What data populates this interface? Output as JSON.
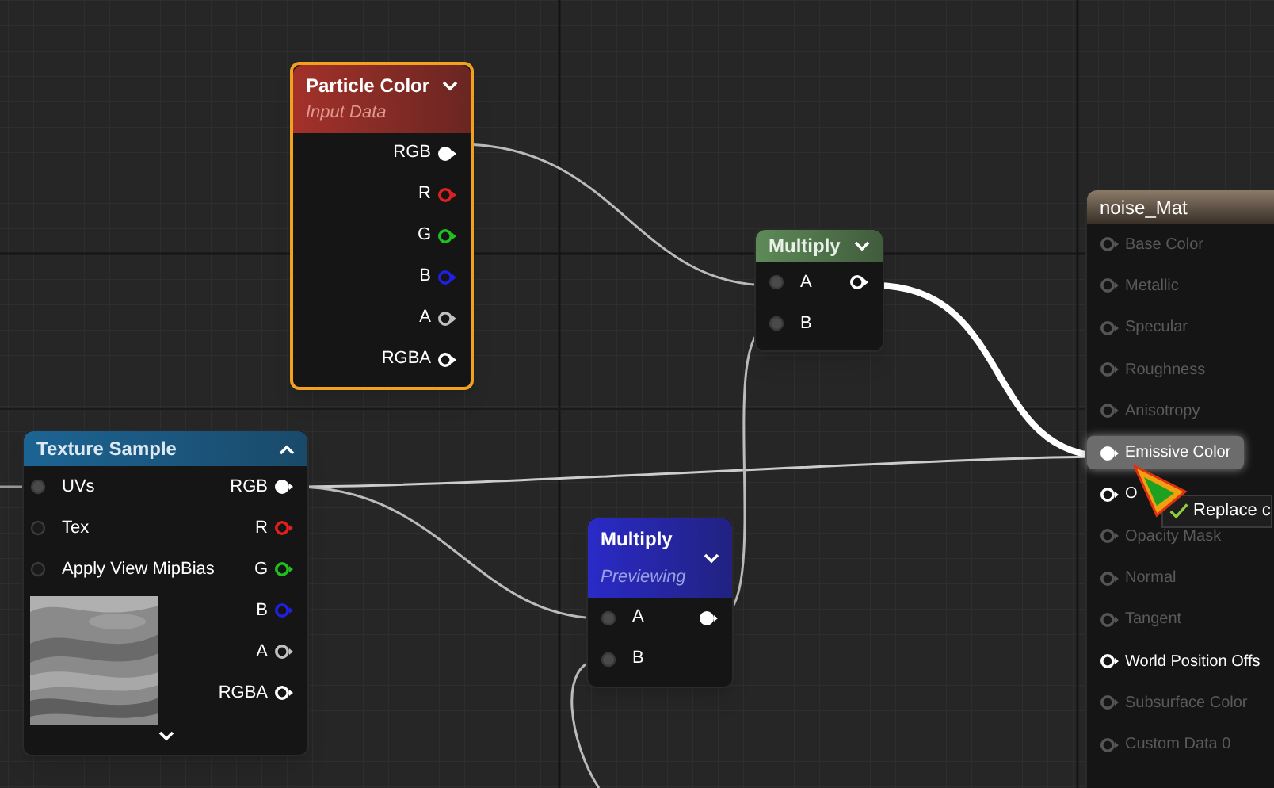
{
  "nodes": [
    {
      "kind": "expression",
      "title": "Particle Color",
      "subtitle": "Input Data",
      "selected": true,
      "previewing": false,
      "advanced_expanded": false,
      "outputs": [
        {
          "label": "RGB",
          "color": "#ffffff",
          "connected": true
        },
        {
          "label": "R",
          "color": "#e02020",
          "connected": false
        },
        {
          "label": "G",
          "color": "#20c020",
          "connected": false
        },
        {
          "label": "B",
          "color": "#2020e0",
          "connected": false
        },
        {
          "label": "A",
          "color": "#c0c0c0",
          "connected": false
        },
        {
          "label": "RGBA",
          "color": "#ffffff",
          "connected": false
        }
      ]
    },
    {
      "kind": "texture",
      "title": "Texture Sample",
      "selected": false,
      "advanced_expanded": true,
      "inputs": [
        {
          "label": "UVs",
          "connected": true
        },
        {
          "label": "Tex",
          "connected": false
        },
        {
          "label": "Apply View MipBias",
          "connected": false
        }
      ],
      "outputs": [
        {
          "label": "RGB",
          "color": "#ffffff",
          "connected": true
        },
        {
          "label": "R",
          "color": "#e02020",
          "connected": false
        },
        {
          "label": "G",
          "color": "#20c020",
          "connected": false
        },
        {
          "label": "B",
          "color": "#2020e0",
          "connected": false
        },
        {
          "label": "A",
          "color": "#c0c0c0",
          "connected": false
        },
        {
          "label": "RGBA",
          "color": "#ffffff",
          "connected": false
        }
      ]
    },
    {
      "kind": "expression",
      "title": "Multiply",
      "selected": false,
      "previewing": false,
      "advanced_expanded": false,
      "inputs": [
        {
          "label": "A",
          "connected": true
        },
        {
          "label": "B",
          "connected": true
        }
      ],
      "outputs": [
        {
          "color": "#ffffff",
          "connected": false
        }
      ]
    },
    {
      "kind": "expression",
      "title": "Multiply",
      "subtitle": "Previewing",
      "selected": false,
      "previewing": true,
      "advanced_expanded": false,
      "inputs": [
        {
          "label": "A",
          "connected": true
        },
        {
          "label": "B",
          "connected": true
        }
      ],
      "outputs": [
        {
          "color": "#ffffff",
          "connected": true
        }
      ]
    },
    {
      "kind": "material",
      "title": "noise_Mat",
      "selected": false,
      "inputs": [
        {
          "label": "Base Color",
          "enabled": false,
          "highlighted": false,
          "connected": false
        },
        {
          "label": "Metallic",
          "enabled": false,
          "highlighted": false,
          "connected": false
        },
        {
          "label": "Specular",
          "enabled": false,
          "highlighted": false,
          "connected": false
        },
        {
          "label": "Roughness",
          "enabled": false,
          "highlighted": false,
          "connected": false
        },
        {
          "label": "Anisotropy",
          "enabled": false,
          "highlighted": false,
          "connected": false
        },
        {
          "label": "Emissive Color",
          "enabled": true,
          "highlighted": true,
          "connected": true
        },
        {
          "label": "O",
          "enabled": true,
          "highlighted": false,
          "connected": false
        },
        {
          "label": "Opacity Mask",
          "enabled": false,
          "highlighted": false,
          "connected": false
        },
        {
          "label": "Normal",
          "enabled": false,
          "highlighted": false,
          "connected": false
        },
        {
          "label": "Tangent",
          "enabled": false,
          "highlighted": false,
          "connected": false
        },
        {
          "label": "World Position Offs",
          "enabled": true,
          "highlighted": false,
          "connected": false
        },
        {
          "label": "Subsurface Color",
          "enabled": false,
          "highlighted": false,
          "connected": false
        },
        {
          "label": "Custom Data 0",
          "enabled": false,
          "highlighted": false,
          "connected": false
        }
      ]
    }
  ],
  "tooltip": {
    "text": "Replace c"
  }
}
